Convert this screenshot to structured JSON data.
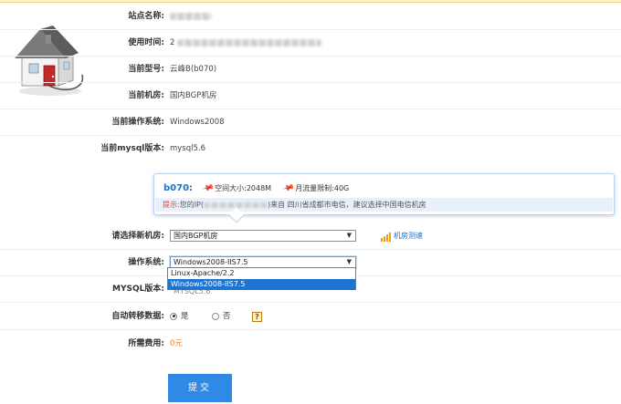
{
  "info": {
    "site_name_label": "站点名称:",
    "usage_time_label": "使用时间:",
    "usage_time_prefix": "2",
    "model_label": "当前型号:",
    "model_value": "云峰B(b070)",
    "room_label": "当前机房:",
    "room_value": "国内BGP机房",
    "os_label": "当前操作系统:",
    "os_value": "Windows2008",
    "mysql_label": "当前mysql版本:",
    "mysql_value": "mysql5.6"
  },
  "tooltip": {
    "code": "b070:",
    "space": "空间大小:2048M",
    "traffic": "月流量限制:40G",
    "warn_label": "提示:",
    "ip_prefix": "您的IP(",
    "ip_suffix": ")来自 四川省成都市电信，建议选择中国电信机房"
  },
  "form": {
    "new_room_label": "请选择新机房:",
    "new_room_value": "国内BGP机房",
    "room_test_link": "机房测速",
    "os_label": "操作系统:",
    "os_value": "Windows2008-IIS7.5",
    "os_options": [
      "Linux-Apache/2.2",
      "Windows2008-IIS7.5"
    ],
    "os_selected_index": 1,
    "mysql_label": "MYSQL版本:",
    "mysql_hidden_value": "MYSQL5.6",
    "migrate_label": "自动转移数据:",
    "migrate_yes": "是",
    "migrate_no": "否",
    "help_icon": "?",
    "fee_label": "所需费用:",
    "fee_value": "0元",
    "submit_label": "提交"
  },
  "colors": {
    "accent": "#2f8ae6",
    "link": "#1e6fc9",
    "warning": "#e23c2a",
    "price": "#f07e1a"
  }
}
